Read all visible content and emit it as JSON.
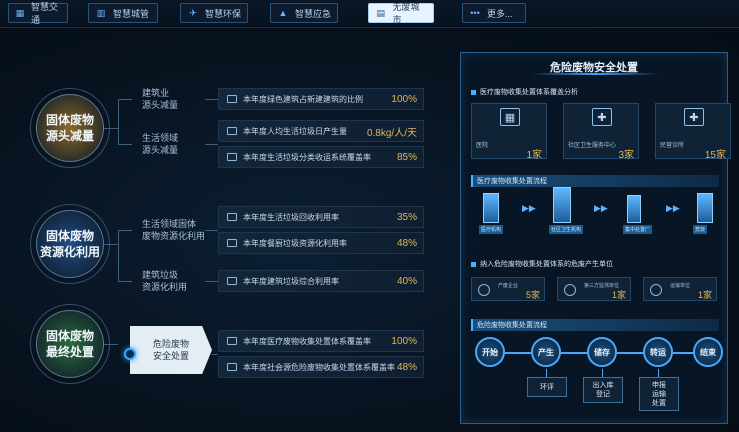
{
  "nav": {
    "tabs": [
      {
        "label": "智慧交通",
        "icon": "grid-icon"
      },
      {
        "label": "智慧城管",
        "icon": "building-icon"
      },
      {
        "label": "智慧环保",
        "icon": "bird-icon"
      },
      {
        "label": "智慧应急",
        "icon": "warning-icon"
      },
      {
        "label": "无废城市",
        "icon": "document-icon",
        "active": true
      },
      {
        "label": "更多...",
        "icon": "dots-icon"
      }
    ]
  },
  "left": {
    "groups": [
      {
        "node": [
          "固体废物",
          "源头减量"
        ],
        "node_color": "#8a6a2a",
        "subs": [
          {
            "label": [
              "建筑业",
              "源头减量"
            ],
            "rows": [
              {
                "text": "本年度绿色建筑占新建建筑的比例",
                "value": "100%"
              }
            ]
          },
          {
            "label": [
              "生活领域",
              "源头减量"
            ],
            "rows": [
              {
                "text": "本年度人均生活垃圾日产生量",
                "value": "0.8kg/人/天"
              },
              {
                "text": "本年度生活垃圾分类收运系统覆盖率",
                "value": "85%"
              }
            ]
          }
        ]
      },
      {
        "node": [
          "固体废物",
          "资源化利用"
        ],
        "node_color": "#1f4e85",
        "subs": [
          {
            "label": [
              "生活领域固体",
              "废物资源化利用"
            ],
            "rows": [
              {
                "text": "本年度生活垃圾回收利用率",
                "value": "35%"
              },
              {
                "text": "本年度餐厨垃圾资源化利用率",
                "value": "48%"
              }
            ]
          },
          {
            "label": [
              "建筑垃圾",
              "资源化利用"
            ],
            "rows": [
              {
                "text": "本年度建筑垃圾综合利用率",
                "value": "40%"
              }
            ]
          }
        ]
      },
      {
        "node": [
          "固体废物",
          "最终处置"
        ],
        "node_color": "#2c6b3c",
        "subs": [
          {
            "label": [
              "危险废物",
              "安全处置"
            ],
            "rows": [
              {
                "text": "本年度医疗废物收集处置体系覆盖率",
                "value": "100%"
              },
              {
                "text": "本年度社会源危险废物收集处置体系覆盖率",
                "value": "48%"
              }
            ]
          }
        ]
      }
    ]
  },
  "panel": {
    "title": "危险废物安全处置",
    "section1": "医疗废物收集处置体系覆盖分析",
    "cards": [
      {
        "label": "医院",
        "count": "1家",
        "icon": "hospital-icon",
        "glyph": "▦"
      },
      {
        "label": "社区卫生服务中心",
        "count": "3家",
        "icon": "cross-diamond-icon",
        "glyph": "✚"
      },
      {
        "label": "民营诊所",
        "count": "15家",
        "icon": "clinic-icon",
        "glyph": "✚"
      }
    ],
    "section2": "医疗废物收集处置流程",
    "flow1": [
      "医疗机构",
      "社区卫生机构",
      "集中处置厂",
      "焚烧"
    ],
    "section3": "纳入危险废物收集处置体系的危废产生单位",
    "mcards": [
      {
        "label": "产废企业",
        "count": "5家"
      },
      {
        "label": "第三方监测单位",
        "count": "1家"
      },
      {
        "label": "运输单位",
        "count": "1家"
      }
    ],
    "section4": "危险废物收集处置流程",
    "flow2": [
      "开始",
      "产生",
      "储存",
      "转运",
      "结束"
    ],
    "flow2_boxes": [
      [
        "环评"
      ],
      [
        "出入库",
        "登记"
      ],
      [
        "申报",
        "运输",
        "处置"
      ]
    ]
  }
}
